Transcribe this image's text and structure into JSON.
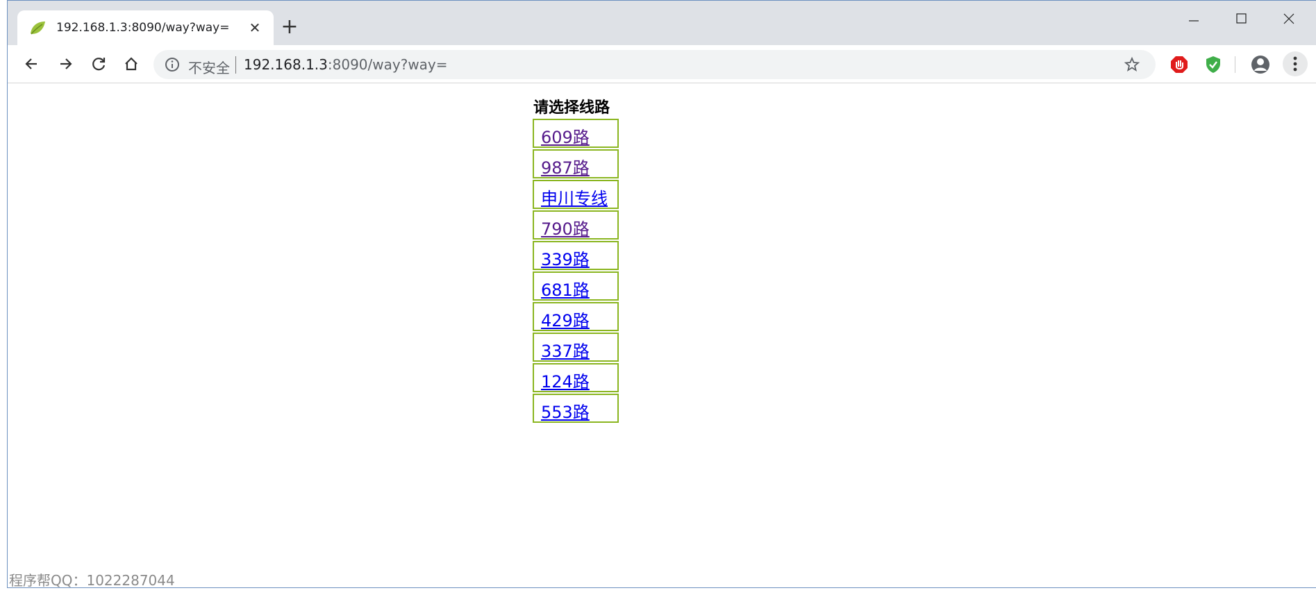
{
  "browser": {
    "tab": {
      "title": "192.168.1.3:8090/way?way=",
      "favicon": "leaf-icon"
    },
    "new_tab_label": "+",
    "toolbar": {
      "security_label": "不安全",
      "url_host": "192.168.1.3",
      "url_rest": ":8090/way?way="
    },
    "icons": [
      "back-icon",
      "forward-icon",
      "reload-icon",
      "home-icon",
      "info-icon",
      "star-icon",
      "stop-extension-icon",
      "shield-extension-icon",
      "profile-icon",
      "menu-icon"
    ]
  },
  "page": {
    "title": "请选择线路",
    "routes": [
      {
        "label": "609路",
        "visited": true
      },
      {
        "label": "987路",
        "visited": true
      },
      {
        "label": "申川专线",
        "visited": false
      },
      {
        "label": "790路",
        "visited": true
      },
      {
        "label": "339路",
        "visited": false
      },
      {
        "label": "681路",
        "visited": false
      },
      {
        "label": "429路",
        "visited": false
      },
      {
        "label": "337路",
        "visited": false
      },
      {
        "label": "124路",
        "visited": false
      },
      {
        "label": "553路",
        "visited": false
      }
    ],
    "watermark": "程序帮QQ：1022287044"
  },
  "colors": {
    "route_border": "#8ab51f",
    "link": "#0000ee",
    "link_visited": "#551a8b"
  }
}
